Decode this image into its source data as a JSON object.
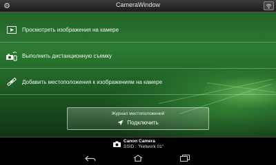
{
  "titlebar": {
    "title": "CameraWindow",
    "settings_icon": "gear-icon",
    "wifi_icon": "wifi-status-icon"
  },
  "menu": {
    "items": [
      {
        "label": "Просмотреть изображения на камере",
        "icon": "play-icon"
      },
      {
        "label": "Выполнить дистанционную съемку",
        "icon": "remote-shoot-icon"
      },
      {
        "label": "Добавить местоположения к изображениям на камере",
        "icon": "satellite-icon"
      }
    ]
  },
  "journal": {
    "title": "Журнал местоположений",
    "connect_label": "Подключить",
    "icon": "location-arrow-icon"
  },
  "camera": {
    "name": "Canon Camera",
    "ssid": "SSID : \"Network 01\"",
    "icon": "camera-icon"
  },
  "navbar": {
    "icons": [
      "back-icon",
      "home-icon",
      "recent-apps-icon"
    ]
  },
  "colors": {
    "accent_green": "#2c7a32",
    "bar_black": "#000000"
  }
}
